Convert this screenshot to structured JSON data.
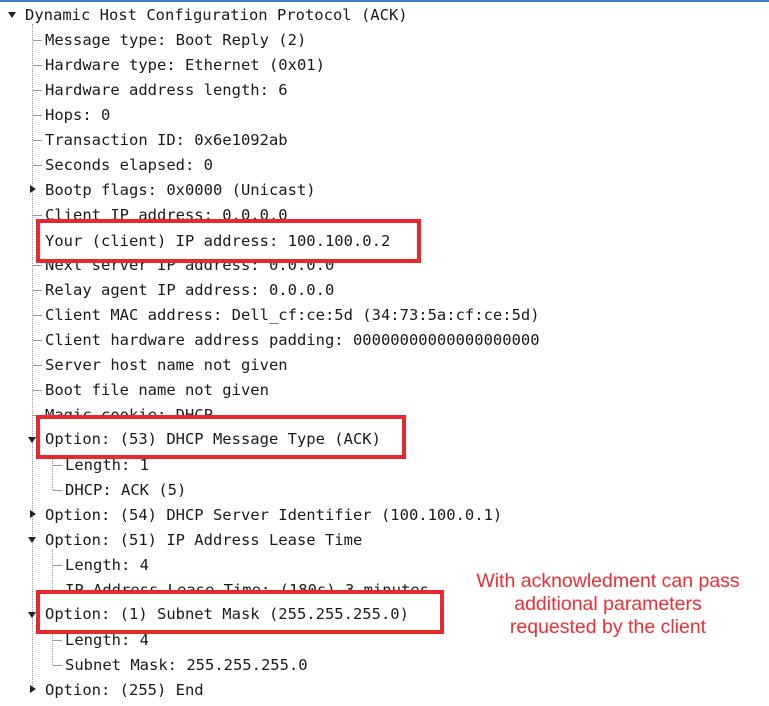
{
  "tree": {
    "root": "Dynamic Host Configuration Protocol (ACK)",
    "fields": {
      "message_type": "Message type: Boot Reply (2)",
      "hardware_type": "Hardware type: Ethernet (0x01)",
      "hw_addr_length": "Hardware address length: 6",
      "hops": "Hops: 0",
      "transaction_id": "Transaction ID: 0x6e1092ab",
      "seconds_elapsed": "Seconds elapsed: 0",
      "bootp_flags": "Bootp flags: 0x0000 (Unicast)",
      "client_ip": "Client IP address: 0.0.0.0",
      "your_ip": "Your (client) IP address: 100.100.0.2",
      "next_server_ip": "Next server IP address: 0.0.0.0",
      "relay_agent_ip": "Relay agent IP address: 0.0.0.0",
      "client_mac": "Client MAC address: Dell_cf:ce:5d (34:73:5a:cf:ce:5d)",
      "client_hw_padding": "Client hardware address padding: 00000000000000000000",
      "server_host_name": "Server host name not given",
      "boot_file_name": "Boot file name not given",
      "magic_cookie": "Magic cookie: DHCP"
    },
    "options": {
      "opt53": "Option: (53) DHCP Message Type (ACK)",
      "opt53_length": "Length: 1",
      "opt53_value": "DHCP: ACK (5)",
      "opt54": "Option: (54) DHCP Server Identifier (100.100.0.1)",
      "opt51": "Option: (51) IP Address Lease Time",
      "opt51_length": "Length: 4",
      "opt51_value": "IP Address Lease Time: (180s) 3 minutes",
      "opt1": "Option: (1) Subnet Mask (255.255.255.0)",
      "opt1_length": "Length: 4",
      "opt1_value": "Subnet Mask: 255.255.255.0",
      "opt255": "Option: (255) End"
    }
  },
  "annotation": {
    "text": "With acknowledment can pass\nadditional parameters\nrequested by the client",
    "color": "#ee2d35"
  },
  "colors": {
    "highlight_border": "#e8282f",
    "selection_line": "#3f7fc8"
  }
}
